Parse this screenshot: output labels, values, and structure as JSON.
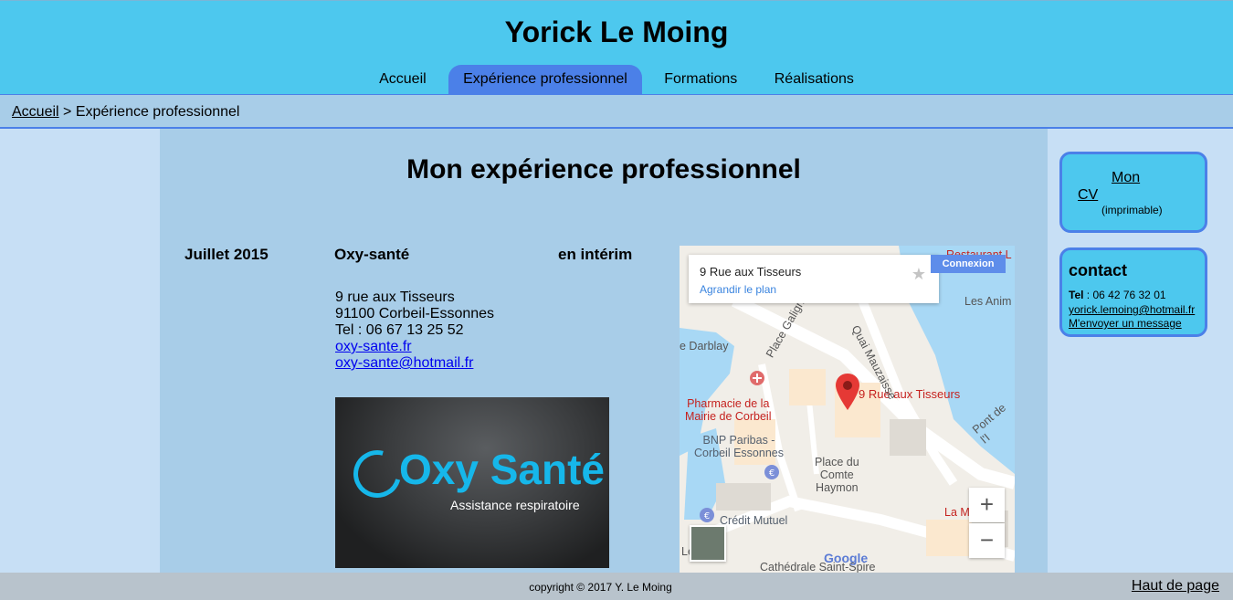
{
  "header": {
    "title": "Yorick Le Moing",
    "nav": [
      {
        "label": "Accueil"
      },
      {
        "label": "Expérience professionnel"
      },
      {
        "label": "Formations"
      },
      {
        "label": "Réalisations"
      }
    ]
  },
  "breadcrumb": {
    "home": "Accueil",
    "separator": " > ",
    "current": "Expérience professionnel"
  },
  "main": {
    "title": "Mon expérience professionnel",
    "entry": {
      "date": "Juillet 2015",
      "company": "Oxy-santé",
      "type": "en intérim",
      "address_line1": "9 rue aux Tisseurs",
      "address_line2": "91100 Corbeil-Essonnes",
      "phone": "Tel : 06 67 13 25 52",
      "website": "oxy-sante.fr",
      "email": "oxy-sante@hotmail.fr",
      "logo_brand": "Oxy Santé",
      "logo_tagline": "Assistance respiratoire"
    }
  },
  "map": {
    "card_address": "9 Rue aux Tisseurs",
    "card_link": "Agrandir le plan",
    "signin": "Connexion",
    "pin_label": "9 Rue aux Tisseurs",
    "labels": {
      "les_anim": "Les Anim",
      "quai": "Quai Mauzaisse",
      "darblay": "e Darblay",
      "place_galignani": "Place Galignani",
      "pharmacie": "Pharmacie de la\nMairie de Corbeil",
      "bnp": "BNP Paribas -\nCorbeil Essonnes",
      "place_comte": "Place du\nComte\nHaymon",
      "pont": "Pont de l'I",
      "credit": "Crédit Mutuel",
      "cathedrale": "Cathédrale Saint-Spire",
      "la_m": "La M",
      "le": "Le",
      "restaurant": "Restaurant L"
    },
    "zoom_in": "+",
    "zoom_out": "−",
    "google": "Google",
    "colors": {
      "water": "#a8d8f5",
      "road": "#ffffff",
      "pin": "#e53935"
    }
  },
  "sidebar": {
    "cv_mon": "Mon",
    "cv_cv": "CV",
    "cv_note": "(imprimable)",
    "contact_title": "contact",
    "tel_label": "Tel",
    "tel_value": ": 06 42 76 32 01",
    "email": "yorick.lemoing@hotmail.fr",
    "message": "M'envoyer un message"
  },
  "footer": {
    "copyright": "copyright © 2017 Y. Le Moing",
    "top_link": "Haut de page"
  },
  "colors": {
    "header_bg": "#4dc8ee",
    "accent": "#4b80e8",
    "main_bg": "#a8cde8",
    "side_bg": "#c7dff5",
    "footer_bg": "#b8c3cc"
  }
}
